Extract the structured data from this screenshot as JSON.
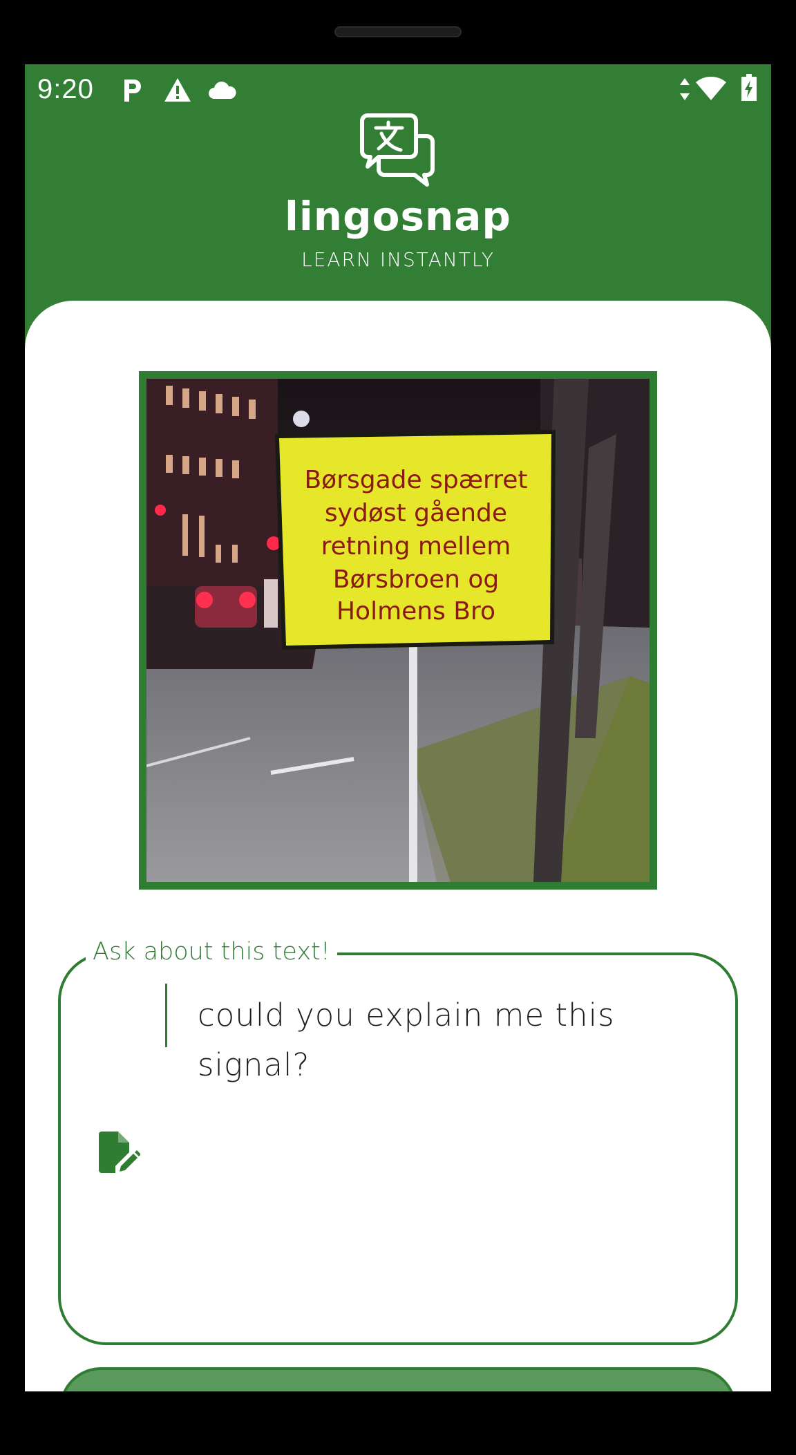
{
  "status_bar": {
    "time": "9:20",
    "left_icons": [
      "parking-icon",
      "warning-icon",
      "cloud-icon"
    ],
    "right_icons": [
      "data-arrows-icon",
      "wifi-icon",
      "battery-charging-icon"
    ]
  },
  "header": {
    "logo": "translate-chat-bubbles-icon",
    "brand": "lingosnap",
    "tagline": "LEARN INSTANTLY"
  },
  "photo": {
    "sign_lines": [
      "Børsgade spærret",
      "sydøst gående",
      "retning mellem",
      "Børsbroen og",
      "Holmens Bro"
    ]
  },
  "question": {
    "label": "Ask about this text!",
    "value": "could you explain me this signal?",
    "icon": "edit-document-icon"
  },
  "colors": {
    "primary": "#327e34",
    "accent": "#2e7d32",
    "button": "#5a9a5e",
    "sign_yellow": "#e6e62a"
  }
}
